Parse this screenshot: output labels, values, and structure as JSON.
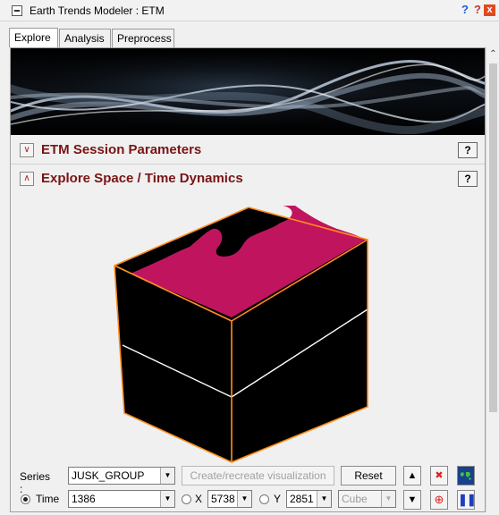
{
  "window": {
    "title": "Earth Trends Modeler : ETM",
    "help_glyph": "?",
    "help2_glyph": "?",
    "close_glyph": "x"
  },
  "tabs": [
    {
      "label": "Explore",
      "active": true
    },
    {
      "label": "Analysis",
      "active": false
    },
    {
      "label": "Preprocess",
      "active": false
    }
  ],
  "sections": {
    "session": {
      "label": "ETM Session Parameters",
      "help": "?",
      "collapsed": true
    },
    "explore": {
      "label": "Explore Space / Time Dynamics",
      "help": "?",
      "collapsed": false
    }
  },
  "controls": {
    "series_label": "Series :",
    "series_value": "JUSK_GROUP",
    "create_button": "Create/recreate visualization",
    "reset_button": "Reset",
    "time_label": "Time",
    "time_value": "1386",
    "x_label": "X",
    "x_value": "5738",
    "y_label": "Y",
    "y_value": "2851",
    "view_value": "Cube",
    "selected_mode": "Time"
  },
  "colors": {
    "accent_text": "#7a1414",
    "cube_surface": "#c0155e",
    "cube_edge": "#ff8c1a",
    "cube_face": "#000000"
  },
  "icons": {
    "banner": "abstract-light-waves",
    "up": "triangle-up-icon",
    "down": "triangle-down-icon",
    "stop": "stop-x-icon",
    "target": "target-icon",
    "map": "world-map-icon",
    "pause": "pause-icon"
  }
}
